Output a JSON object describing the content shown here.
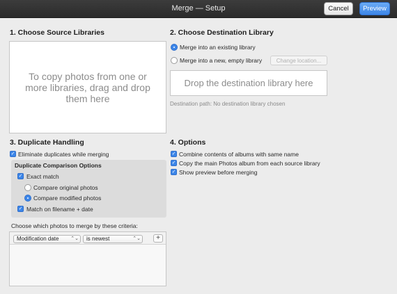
{
  "window": {
    "title": "Merge — Setup",
    "cancel_label": "Cancel",
    "preview_label": "Preview"
  },
  "source": {
    "heading": "1. Choose Source Libraries",
    "drop_hint": "To copy photos from one or more libraries, drag and drop them here"
  },
  "destination": {
    "heading": "2. Choose Destination Library",
    "option_existing": "Merge into an existing library",
    "option_new": "Merge into a new, empty library",
    "selected_option": "existing",
    "change_location_label": "Change location...",
    "drop_hint": "Drop the destination library here",
    "path_text": "Destination path: No destination library chosen"
  },
  "duplicates": {
    "heading": "3. Duplicate Handling",
    "eliminate_label": "Eliminate duplicates while merging",
    "eliminate_checked": true,
    "comparison_heading": "Duplicate Comparison Options",
    "exact_match_label": "Exact match",
    "exact_match_checked": true,
    "compare_original_label": "Compare original photos",
    "compare_modified_label": "Compare modified photos",
    "compare_selected": "modified",
    "filename_date_label": "Match on filename + date",
    "filename_date_checked": true,
    "criteria_prompt": "Choose which photos to merge by these criteria:",
    "criteria_field": "Modification date",
    "criteria_rule": "is newest",
    "add_criteria_label": "+"
  },
  "options": {
    "heading": "4. Options",
    "combine_albums_label": "Combine contents of albums with same name",
    "combine_albums_checked": true,
    "copy_main_album_label": "Copy the main Photos album from each source library",
    "copy_main_album_checked": true,
    "show_preview_label": "Show preview before merging",
    "show_preview_checked": true
  },
  "icons": {
    "check_glyph": "✓",
    "popup_arrows_glyph": "⌃⌄"
  }
}
